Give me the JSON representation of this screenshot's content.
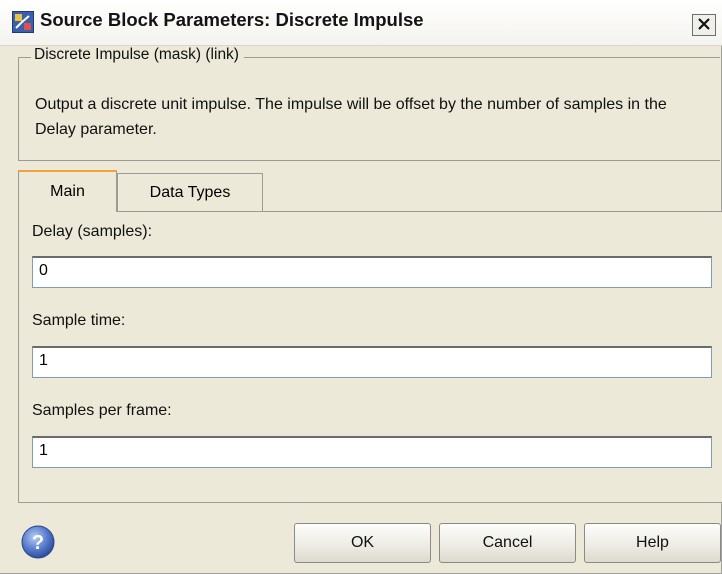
{
  "window": {
    "title": "Source Block Parameters: Discrete Impulse",
    "close_glyph": "×"
  },
  "group": {
    "legend": "Discrete Impulse  (mask) (link)",
    "description": "Output a discrete unit impulse.  The impulse will be offset by the number of samples in the Delay parameter."
  },
  "tabs": [
    {
      "label": "Main",
      "active": true
    },
    {
      "label": "Data Types",
      "active": false
    }
  ],
  "fields": [
    {
      "label": "Delay (samples):",
      "value": "0"
    },
    {
      "label": "Sample time:",
      "value": "1"
    },
    {
      "label": "Samples per frame:",
      "value": "1"
    }
  ],
  "buttons": {
    "ok": "OK",
    "cancel": "Cancel",
    "help": "Help"
  },
  "icons": {
    "title": "simulink-block-icon",
    "help": "question-mark-icon",
    "close": "close-icon"
  },
  "colors": {
    "background": "#ECE9D8",
    "active_tab_accent": "#F3A33A",
    "input_border": "#7F9DB9"
  }
}
